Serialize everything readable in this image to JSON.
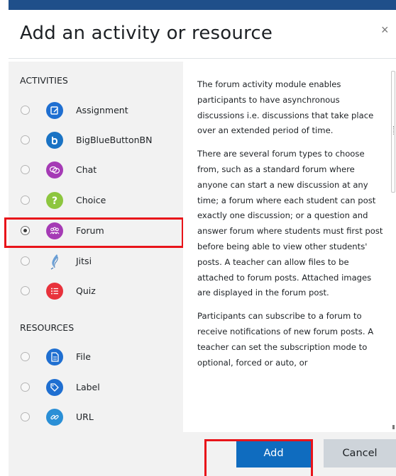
{
  "dialog": {
    "title": "Add an activity or resource",
    "close_glyph": "×"
  },
  "sections": {
    "activities_heading": "ACTIVITIES",
    "resources_heading": "RESOURCES"
  },
  "activities": [
    {
      "label": "Assignment",
      "icon": "assignment-icon",
      "color": "#1f6fd1",
      "selected": false
    },
    {
      "label": "BigBlueButtonBN",
      "icon": "bigbluebutton-icon",
      "color": "#1a73c4",
      "selected": false
    },
    {
      "label": "Chat",
      "icon": "chat-icon",
      "color": "#a53bb5",
      "selected": false
    },
    {
      "label": "Choice",
      "icon": "choice-icon",
      "color": "#8dc63f",
      "selected": false
    },
    {
      "label": "Forum",
      "icon": "forum-icon",
      "color": "#a53bb5",
      "selected": true
    },
    {
      "label": "Jitsi",
      "icon": "jitsi-icon",
      "color": "#6a9fd6",
      "selected": false
    },
    {
      "label": "Quiz",
      "icon": "quiz-icon",
      "color": "#e8323c",
      "selected": false
    }
  ],
  "resources": [
    {
      "label": "File",
      "icon": "file-icon",
      "color": "#1f6fd1",
      "selected": false
    },
    {
      "label": "Label",
      "icon": "label-icon",
      "color": "#1f6fd1",
      "selected": false
    },
    {
      "label": "URL",
      "icon": "url-icon",
      "color": "#2a8fd6",
      "selected": false
    }
  ],
  "description": {
    "paragraphs": [
      "The forum activity module enables participants to have asynchronous discussions i.e. discussions that take place over an extended period of time.",
      "There are several forum types to choose from, such as a standard forum where anyone can start a new discussion at any time; a forum where each student can post exactly one discussion; or a question and answer forum where students must first post before being able to view other students' posts. A teacher can allow files to be attached to forum posts. Attached images are displayed in the forum post.",
      "Participants can subscribe to a forum to receive notifications of new forum posts. A teacher can set the subscription mode to optional, forced or auto, or"
    ]
  },
  "footer": {
    "add_label": "Add",
    "cancel_label": "Cancel"
  },
  "colors": {
    "primary": "#0f6cbf",
    "highlight": "#e8141a",
    "topbar": "#1f4f8a"
  }
}
